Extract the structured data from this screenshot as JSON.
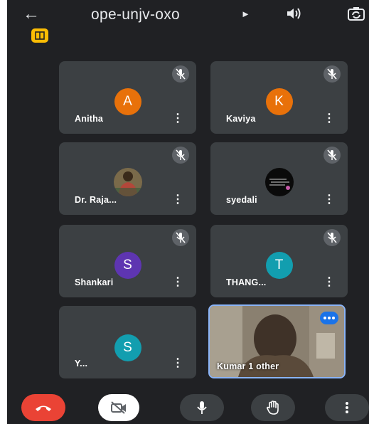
{
  "app": {
    "meeting_code": "ope-unjv-oxo"
  },
  "participants": [
    {
      "name": "Anitha",
      "initial": "A",
      "color": "#e8710a",
      "muted": true,
      "kind": "initial"
    },
    {
      "name": "Kaviya",
      "initial": "K",
      "color": "#e8710a",
      "muted": true,
      "kind": "initial"
    },
    {
      "name": "Dr. Raja...",
      "muted": true,
      "kind": "photo"
    },
    {
      "name": "syedali",
      "muted": true,
      "kind": "photo"
    },
    {
      "name": "Shankari",
      "initial": "S",
      "color": "#5e35b1",
      "muted": true,
      "kind": "initial"
    },
    {
      "name": "THANG...",
      "initial": "T",
      "color": "#129eaf",
      "muted": true,
      "kind": "initial"
    },
    {
      "name": "Y...",
      "initial": "S",
      "color": "#129eaf",
      "muted": false,
      "kind": "initial"
    },
    {
      "name": "Kumar",
      "others": "1 other",
      "kind": "video",
      "speaking": true
    }
  ],
  "colors": {
    "background": "#202124",
    "tile": "#3c4043",
    "end_call": "#ea4335",
    "room_badge": "#fbbc04",
    "speaking": "#1a73e8"
  },
  "icons": {
    "back": "arrow-left-icon",
    "speaker": "speaker-icon",
    "switch_camera": "switch-camera-icon",
    "mute": "mic-off-icon",
    "end_call": "end-call-icon",
    "camera_off": "camera-off-icon",
    "mic": "mic-icon",
    "hand": "raise-hand-icon",
    "more": "more-vert-icon"
  }
}
